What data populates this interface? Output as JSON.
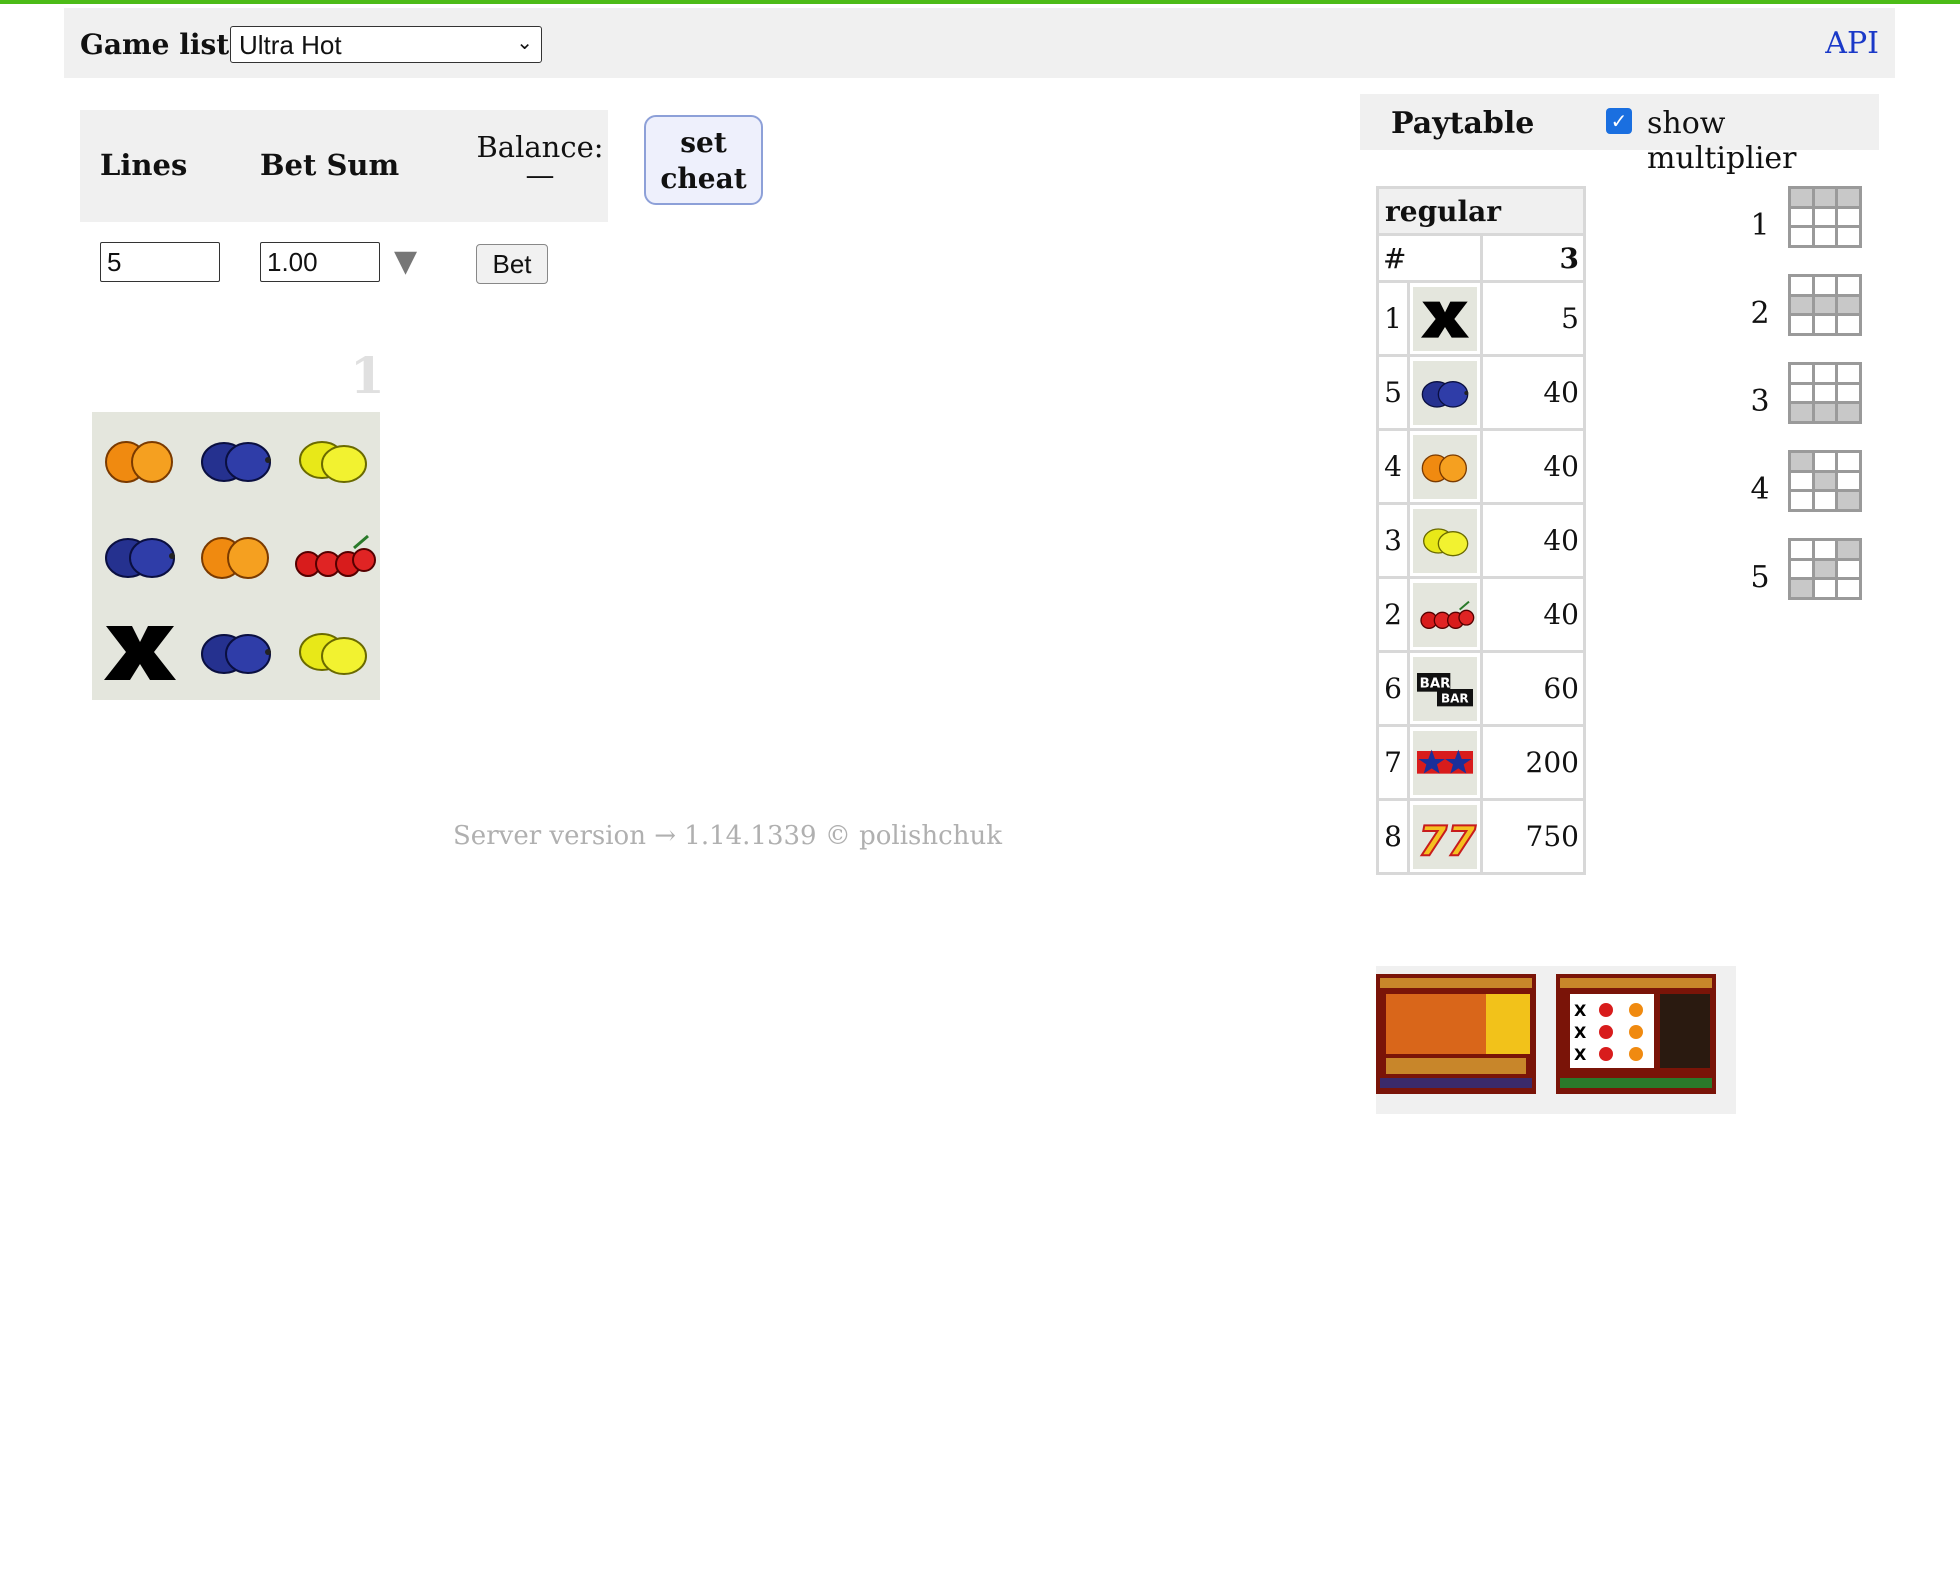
{
  "header": {
    "game_list_label": "Game list:",
    "game_selected": "Ultra Hot",
    "api_link": "API"
  },
  "bet_panel": {
    "lines_label": "Lines",
    "bet_sum_label": "Bet Sum",
    "balance_label": "Balance:",
    "balance_value": "—",
    "lines_value": "5",
    "bet_sum_value": "1.00",
    "bet_button": "Bet",
    "cheat_button": "set cheat"
  },
  "reels": {
    "number": "1",
    "grid": [
      [
        "orange",
        "plum",
        "lemon"
      ],
      [
        "plum",
        "orange",
        "cherry"
      ],
      [
        "x",
        "plum",
        "lemon"
      ]
    ]
  },
  "footer": {
    "text": "Server version → 1.14.1339   ©   polishchuk"
  },
  "paytable": {
    "title": "Paytable",
    "show_multiplier_label": "show multiplier",
    "show_multiplier_checked": true,
    "section": "regular",
    "hash_header": "#",
    "count_header": "3",
    "rows": [
      {
        "id": "1",
        "symbol": "x-icon",
        "payout": "5"
      },
      {
        "id": "5",
        "symbol": "plum-icon",
        "payout": "40"
      },
      {
        "id": "4",
        "symbol": "orange-icon",
        "payout": "40"
      },
      {
        "id": "3",
        "symbol": "lemon-icon",
        "payout": "40"
      },
      {
        "id": "2",
        "symbol": "cherry-icon",
        "payout": "40"
      },
      {
        "id": "6",
        "symbol": "bar-icon",
        "payout": "60"
      },
      {
        "id": "7",
        "symbol": "stars-icon",
        "payout": "200"
      },
      {
        "id": "8",
        "symbol": "seven-icon",
        "payout": "750"
      }
    ]
  },
  "paylines": [
    {
      "number": "1",
      "pattern": [
        [
          1,
          1,
          1
        ],
        [
          0,
          0,
          0
        ],
        [
          0,
          0,
          0
        ]
      ]
    },
    {
      "number": "2",
      "pattern": [
        [
          0,
          0,
          0
        ],
        [
          1,
          1,
          1
        ],
        [
          0,
          0,
          0
        ]
      ]
    },
    {
      "number": "3",
      "pattern": [
        [
          0,
          0,
          0
        ],
        [
          0,
          0,
          0
        ],
        [
          1,
          1,
          1
        ]
      ]
    },
    {
      "number": "4",
      "pattern": [
        [
          1,
          0,
          0
        ],
        [
          0,
          1,
          0
        ],
        [
          0,
          0,
          1
        ]
      ]
    },
    {
      "number": "5",
      "pattern": [
        [
          0,
          0,
          1
        ],
        [
          0,
          1,
          0
        ],
        [
          1,
          0,
          0
        ]
      ]
    }
  ],
  "colors": {
    "accent_bar": "#4cbb17",
    "link": "#1a39c8",
    "panel_bg": "#f0f0f0"
  }
}
